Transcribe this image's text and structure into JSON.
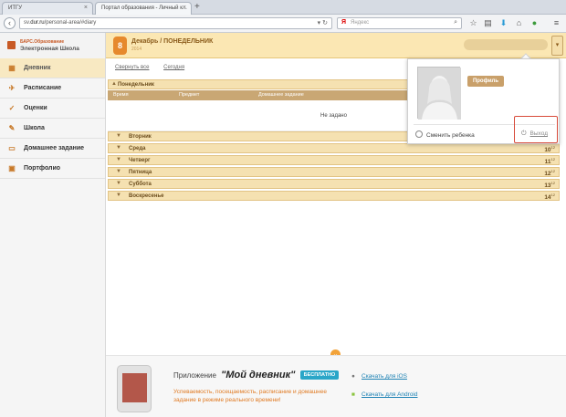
{
  "browser": {
    "tabs": [
      {
        "label": "ИТГУ",
        "close": "×"
      },
      {
        "label": "Портал образования - Личный к...",
        "close": "×"
      }
    ],
    "new_tab": "+",
    "url_prefix": "sv.",
    "url_host": "dur.ru",
    "url_path": "/personal-area/#diary",
    "search_placeholder": "Яндекс"
  },
  "brand": {
    "top": "БАРС.Образование",
    "name": "Электронная Школа"
  },
  "header": {
    "date_badge": "8",
    "month_day": "Декабрь / ПОНЕДЕЛЬНИК",
    "year": "2014"
  },
  "sidebar": {
    "items": [
      {
        "label": "Дневник",
        "icon": "diary-icon"
      },
      {
        "label": "Расписание",
        "icon": "schedule-icon"
      },
      {
        "label": "Оценки",
        "icon": "grades-icon"
      },
      {
        "label": "Школа",
        "icon": "school-icon"
      },
      {
        "label": "Домашнее задание",
        "icon": "homework-icon"
      },
      {
        "label": "Портфолио",
        "icon": "portfolio-icon"
      }
    ]
  },
  "diary": {
    "collapse_all": "Свернуть все",
    "today": "Сегодня",
    "open_day": "Понедельник",
    "columns": [
      "Время",
      "Предмет",
      "Домашнее задание"
    ],
    "empty_text": "Не задано",
    "days": [
      {
        "name": "Вторник",
        "num": "9",
        "sup": "12"
      },
      {
        "name": "Среда",
        "num": "10",
        "sup": "12"
      },
      {
        "name": "Четверг",
        "num": "11",
        "sup": "12"
      },
      {
        "name": "Пятница",
        "num": "12",
        "sup": "12"
      },
      {
        "name": "Суббота",
        "num": "13",
        "sup": "12"
      },
      {
        "name": "Воскресенье",
        "num": "14",
        "sup": "12"
      }
    ]
  },
  "popup": {
    "profile": "Профиль",
    "switch_child": "Сменить ребенка",
    "logout": "Выход"
  },
  "footer": {
    "app_prefix": "Приложение",
    "app_name": "\"Мой дневник\"",
    "free": "БЕСПЛАТНО",
    "desc": "Успеваемость, посещаемость, расписание и домашнее задание в режиме реального времени!",
    "ios": "Скачать для iOS",
    "android": "Скачать для Android"
  }
}
